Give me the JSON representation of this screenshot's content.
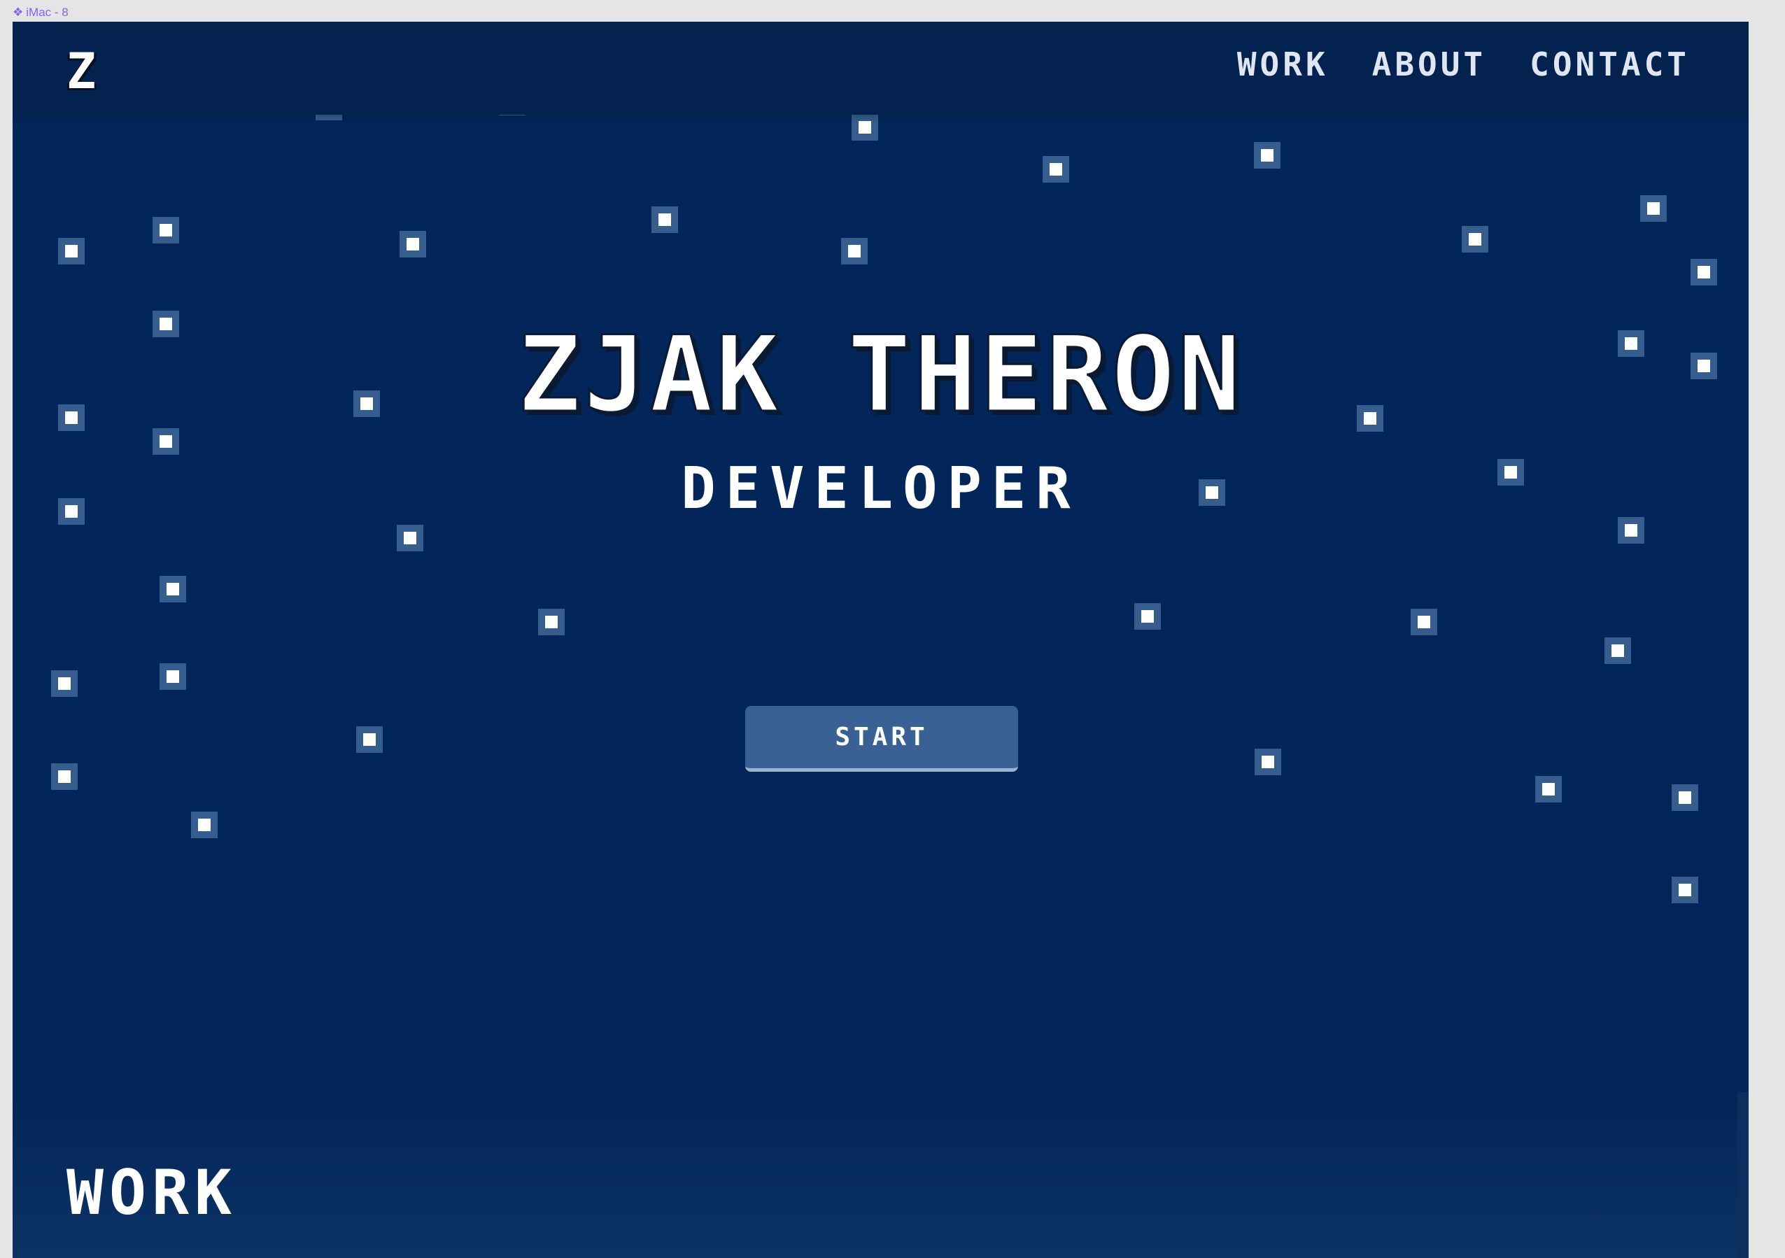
{
  "canvas": {
    "frame_label": "iMac - 8",
    "frame_icon": "component-icon"
  },
  "header": {
    "logo": "Z",
    "nav": [
      {
        "label": "WORK"
      },
      {
        "label": "ABOUT"
      },
      {
        "label": "CONTACT"
      }
    ]
  },
  "hero": {
    "title": "ZJAK THERON",
    "subtitle": "DEVELOPER",
    "cta_label": "START"
  },
  "sections": {
    "work_heading": "WORK"
  },
  "colors": {
    "background": "#03265a",
    "navbar": "#04224f",
    "button": "#3a6194",
    "star_glow": "#355d8d",
    "star": "#ffffff",
    "text": "#ffffff"
  }
}
